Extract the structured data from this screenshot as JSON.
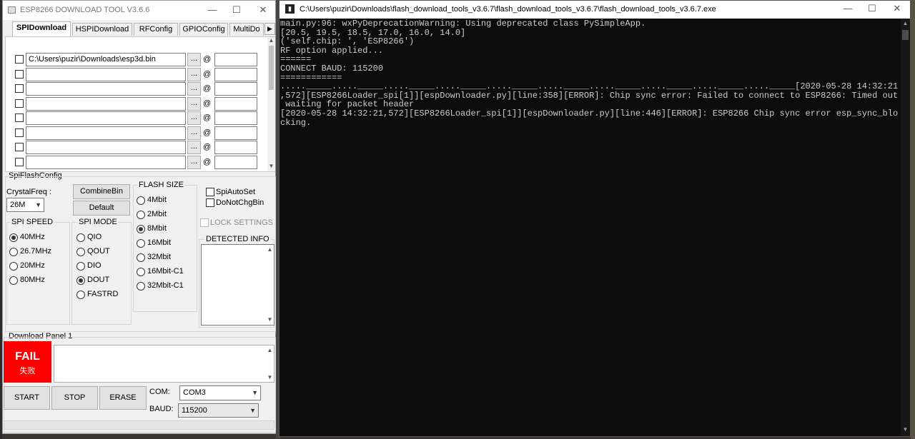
{
  "tool": {
    "title": "ESP8266 DOWNLOAD TOOL V3.6.6",
    "window_buttons": {
      "min": "—",
      "max": "☐",
      "close": "✕"
    },
    "tabs": [
      "SPIDownload",
      "HSPIDownload",
      "RFConfig",
      "GPIOConfig",
      "MultiDo"
    ],
    "tab_scroll": "▶",
    "files": [
      {
        "path": "C:\\Users\\puzir\\Downloads\\esp3d.bin",
        "btn": "...",
        "at": "@",
        "addr": ""
      },
      {
        "path": "",
        "btn": "...",
        "at": "@",
        "addr": ""
      },
      {
        "path": "",
        "btn": "...",
        "at": "@",
        "addr": ""
      },
      {
        "path": "",
        "btn": "...",
        "at": "@",
        "addr": ""
      },
      {
        "path": "",
        "btn": "...",
        "at": "@",
        "addr": ""
      },
      {
        "path": "",
        "btn": "...",
        "at": "@",
        "addr": ""
      },
      {
        "path": "",
        "btn": "...",
        "at": "@",
        "addr": ""
      },
      {
        "path": "",
        "btn": "...",
        "at": "@",
        "addr": ""
      }
    ],
    "spiflash": {
      "title": "SpiFlashConfig",
      "crystal_label": "CrystalFreq :",
      "crystal_value": "26M",
      "combine_btn": "CombineBin",
      "default_btn": "Default",
      "spi_speed": {
        "title": "SPI SPEED",
        "options": [
          "40MHz",
          "26.7MHz",
          "20MHz",
          "80MHz"
        ],
        "selected": "40MHz"
      },
      "spi_mode": {
        "title": "SPI MODE",
        "options": [
          "QIO",
          "QOUT",
          "DIO",
          "DOUT",
          "FASTRD"
        ],
        "selected": "DOUT"
      },
      "flash_size": {
        "title": "FLASH SIZE",
        "options": [
          "4Mbit",
          "2Mbit",
          "8Mbit",
          "16Mbit",
          "32Mbit",
          "16Mbit-C1",
          "32Mbit-C1"
        ],
        "selected": "8Mbit"
      },
      "spi_auto_set": "SpiAutoSet",
      "do_not_chg_bin": "DoNotChgBin",
      "lock_settings": "LOCK SETTINGS",
      "detected_info": "DETECTED INFO"
    },
    "download_panel": {
      "title": "Download Panel 1",
      "status": "FAIL",
      "status_sub": "失败",
      "status_color": "#ff0000",
      "start_btn": "START",
      "stop_btn": "STOP",
      "erase_btn": "ERASE",
      "com_label": "COM:",
      "com_value": "COM3",
      "baud_label": "BAUD:",
      "baud_value": "115200"
    }
  },
  "console": {
    "title": "C:\\Users\\puzir\\Downloads\\flash_download_tools_v3.6.7\\flash_download_tools_v3.6.7\\flash_download_tools_v3.6.7.exe",
    "window_buttons": {
      "min": "—",
      "max": "☐",
      "close": "✕"
    },
    "lines": [
      "main.py:96: wxPyDeprecationWarning: Using deprecated class PySimpleApp.",
      "[20.5, 19.5, 18.5, 17.0, 16.0, 14.0]",
      "('self.chip: ', 'ESP8266')",
      "RF option applied...",
      "======",
      "CONNECT BAUD: 115200",
      "============",
      "....._____....._____....._____....._____....._____....._____....._____....._____....._____....._____[2020-05-28 14:32:21",
      ",572][ESP8266Loader_spi[1]][espDownloader.py][line:358][ERROR]: Chip sync error: Failed to connect to ESP8266: Timed out",
      " waiting for packet header",
      "[2020-05-28 14:32:21,572][ESP8266Loader_spi[1]][espDownloader.py][line:446][ERROR]: ESP8266 Chip sync error esp_sync_blo",
      "cking."
    ]
  }
}
